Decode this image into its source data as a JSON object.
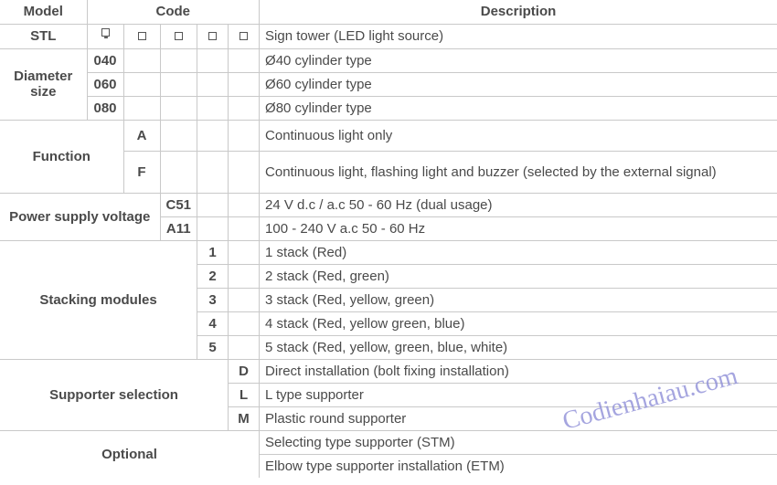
{
  "header": {
    "model": "Model",
    "code": "Code",
    "description": "Description"
  },
  "rows": {
    "stl": {
      "label": "STL",
      "desc": "Sign tower (LED light source)"
    },
    "diam": {
      "label": "Diameter size",
      "r040": {
        "code": "040",
        "desc": "Ø40 cylinder type"
      },
      "r060": {
        "code": "060",
        "desc": "Ø60 cylinder type"
      },
      "r080": {
        "code": "080",
        "desc": "Ø80 cylinder type"
      }
    },
    "func": {
      "label": "Function",
      "a": {
        "code": "A",
        "desc": "Continuous light only"
      },
      "f": {
        "code": "F",
        "desc": "Continuous light, flashing light and buzzer (selected by the external signal)"
      }
    },
    "psv": {
      "label": "Power supply voltage",
      "c51": {
        "code": "C51",
        "desc": "24 V d.c / a.c 50 - 60 Hz (dual usage)"
      },
      "a11": {
        "code": "A11",
        "desc": "100 - 240 V a.c 50 - 60 Hz"
      }
    },
    "stack": {
      "label": "Stacking modules",
      "s1": {
        "code": "1",
        "desc": "1 stack (Red)"
      },
      "s2": {
        "code": "2",
        "desc": "2 stack (Red, green)"
      },
      "s3": {
        "code": "3",
        "desc": "3 stack (Red, yellow, green)"
      },
      "s4": {
        "code": "4",
        "desc": "4 stack (Red, yellow green, blue)"
      },
      "s5": {
        "code": "5",
        "desc": "5 stack (Red, yellow, green, blue, white)"
      }
    },
    "supp": {
      "label": "Supporter selection",
      "d": {
        "code": "D",
        "desc": "Direct installation (bolt fixing installation)"
      },
      "l": {
        "code": "L",
        "desc": "L type supporter"
      },
      "m": {
        "code": "M",
        "desc": "Plastic round supporter"
      }
    },
    "opt": {
      "label": "Optional",
      "o1": {
        "desc": "Selecting type supporter (STM)"
      },
      "o2": {
        "desc": "Elbow type supporter installation (ETM)"
      }
    }
  },
  "watermark": "Codienhaiau.com"
}
